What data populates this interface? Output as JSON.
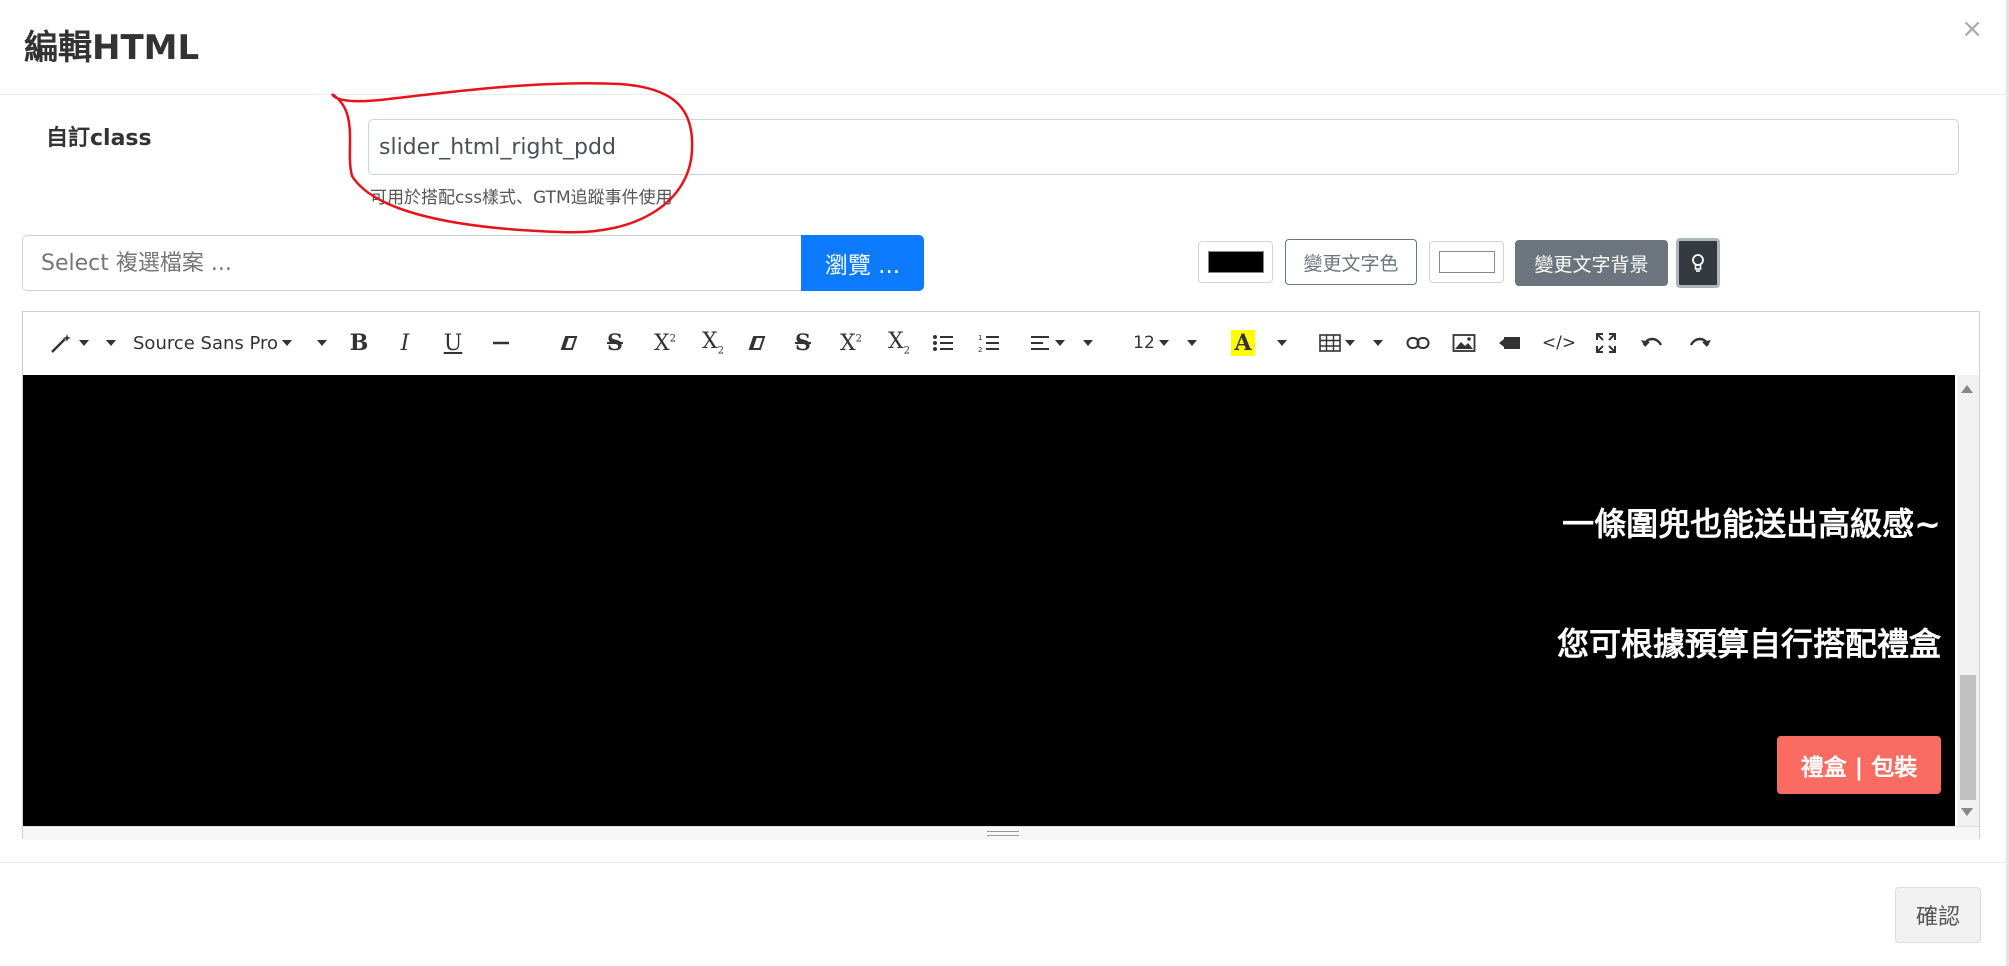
{
  "modal": {
    "title": "編輯HTML",
    "close_label": "×"
  },
  "custom_class": {
    "label": "自訂class",
    "value": "slider_html_right_pdd",
    "help": "可用於搭配css樣式、GTM追蹤事件使用"
  },
  "file": {
    "placeholder": "Select 複選檔案 ...",
    "browse_label": "瀏覽 ..."
  },
  "color_tools": {
    "text_color_swatch": "#000000",
    "text_color_label": "變更文字色",
    "bg_color_swatch": "#ffffff",
    "bg_color_label": "變更文字背景"
  },
  "toolbar": {
    "font_name": "Source Sans Pro",
    "font_size": "12",
    "highlight_color": "#ffff00"
  },
  "editor_content": {
    "background": "#000000",
    "line1": "一條圍兜也能送出高級感~",
    "line2": "您可根據預算自行搭配禮盒",
    "button_label": "禮盒 | 包裝",
    "button_color": "#fa6b61"
  },
  "footer": {
    "confirm_label": "確認"
  },
  "annotation": {
    "color": "#e8131a"
  }
}
